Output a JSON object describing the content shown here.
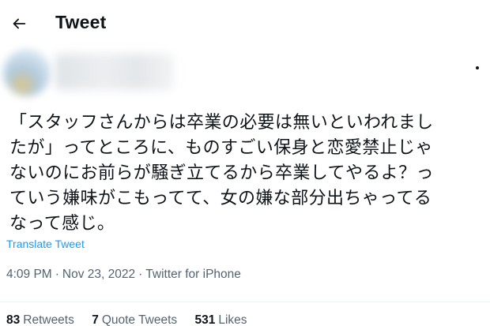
{
  "header": {
    "title": "Tweet",
    "back_icon": "arrow-left-icon"
  },
  "author": {
    "avatar_icon": "avatar-blurred",
    "more_icon": "more-dots-icon"
  },
  "tweet": {
    "text": "「スタッフさんからは卒業の必要は無いといわれまし\nたが」ってところに、ものすごい保身と恋愛禁止じゃ\nないのにお前らが騒ぎ立てるから卒業してやるよ？っ\nていう嫌味がこもってて、女の嫌な部分出ちゃってる\nなって感じ。",
    "translate_label": "Translate Tweet",
    "time": "4:09 PM",
    "separator": "·",
    "date": "Nov 23, 2022",
    "source": "Twitter for iPhone"
  },
  "stats": {
    "retweets_count": "83",
    "retweets_label": "Retweets",
    "quotes_count": "7",
    "quotes_label": "Quote Tweets",
    "likes_count": "531",
    "likes_label": "Likes"
  },
  "colors": {
    "link": "#1d9bf0",
    "secondary_text": "#536471",
    "primary_text": "#0f1419"
  }
}
